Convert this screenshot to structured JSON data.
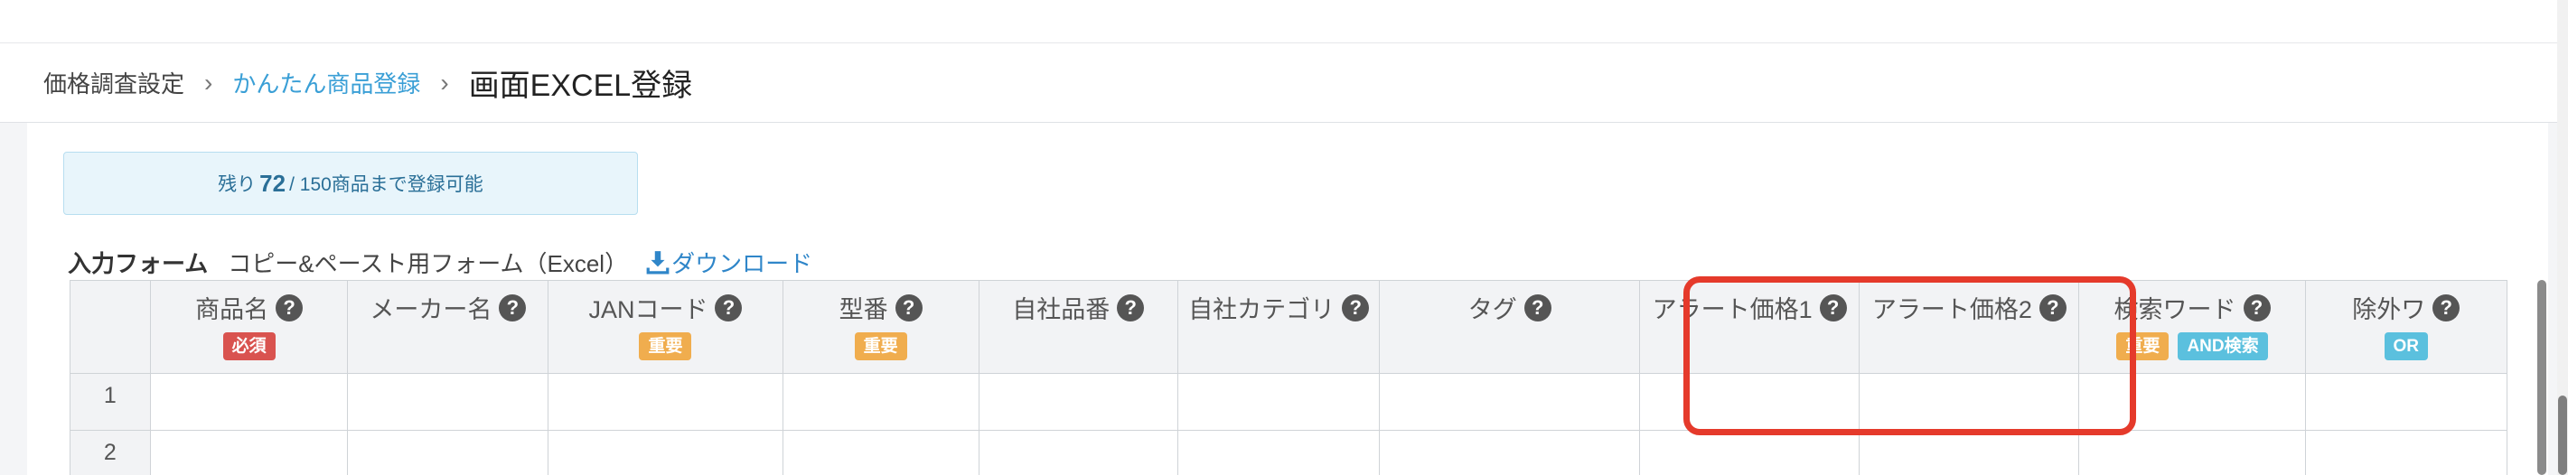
{
  "breadcrumb": {
    "items": [
      "価格調査設定",
      "かんたん商品登録"
    ],
    "current": "画面EXCEL登録",
    "separator": "›"
  },
  "remaining": {
    "prefix": "残り",
    "count": "72",
    "suffix": "/ 150商品まで登録可能"
  },
  "form": {
    "title": "入力フォーム",
    "subtitle": "コピー&ペースト用フォーム（Excel）",
    "download_label": "ダウンロード"
  },
  "help_glyph": "?",
  "columns": [
    {
      "label": "商品名",
      "badges": [
        {
          "text": "必須",
          "color": "#d9534f"
        }
      ]
    },
    {
      "label": "メーカー名",
      "badges": []
    },
    {
      "label": "JANコード",
      "badges": [
        {
          "text": "重要",
          "color": "#f0ad4e"
        }
      ]
    },
    {
      "label": "型番",
      "badges": [
        {
          "text": "重要",
          "color": "#f0ad4e"
        }
      ]
    },
    {
      "label": "自社品番",
      "badges": []
    },
    {
      "label": "自社カテゴリ",
      "badges": []
    },
    {
      "label": "タグ",
      "badges": []
    },
    {
      "label": "アラート価格1",
      "badges": []
    },
    {
      "label": "アラート価格2",
      "badges": []
    },
    {
      "label": "検索ワード",
      "badges": [
        {
          "text": "重要",
          "color": "#f0ad4e"
        },
        {
          "text": "AND検索",
          "color": "#5bc0de"
        }
      ]
    },
    {
      "label": "除外ワ",
      "badges": [
        {
          "text": "OR",
          "color": "#5bc0de"
        }
      ]
    }
  ],
  "rows": [
    "1",
    "2"
  ],
  "colors": {
    "highlight": "#e53a2b",
    "link": "#3a9fd6",
    "info_bg": "#e8f5fb"
  }
}
